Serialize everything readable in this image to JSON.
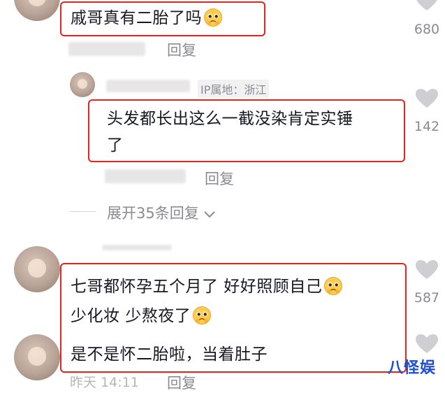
{
  "comments": [
    {
      "text": "戚哥真有二胎了吗",
      "emoji": "pleading-face-emoji",
      "reply_label": "回复",
      "likes": "680"
    },
    {
      "ip_location": "IP属地：浙江",
      "text_line1": "头发都长出这么一截没染肯定实锤",
      "text_line2": "了",
      "reply_label": "回复",
      "likes": "142"
    },
    {
      "text_line1": "七哥都怀孕五个月了 好好照顾自己",
      "text_line2": "少化妆 少熬夜了",
      "text_line3": "是不是怀二胎啦，当着肚子",
      "reply_label": "回复",
      "likes": "587"
    }
  ],
  "expand_replies": "展开35条回复",
  "footer_partial": "昨天 14:11",
  "watermark": "八怪娱",
  "colors": {
    "highlight_border": "#e1251b",
    "secondary_text": "#8a8b91",
    "heart_gray": "#cfcfd3",
    "watermark": "#1b4fd6"
  }
}
